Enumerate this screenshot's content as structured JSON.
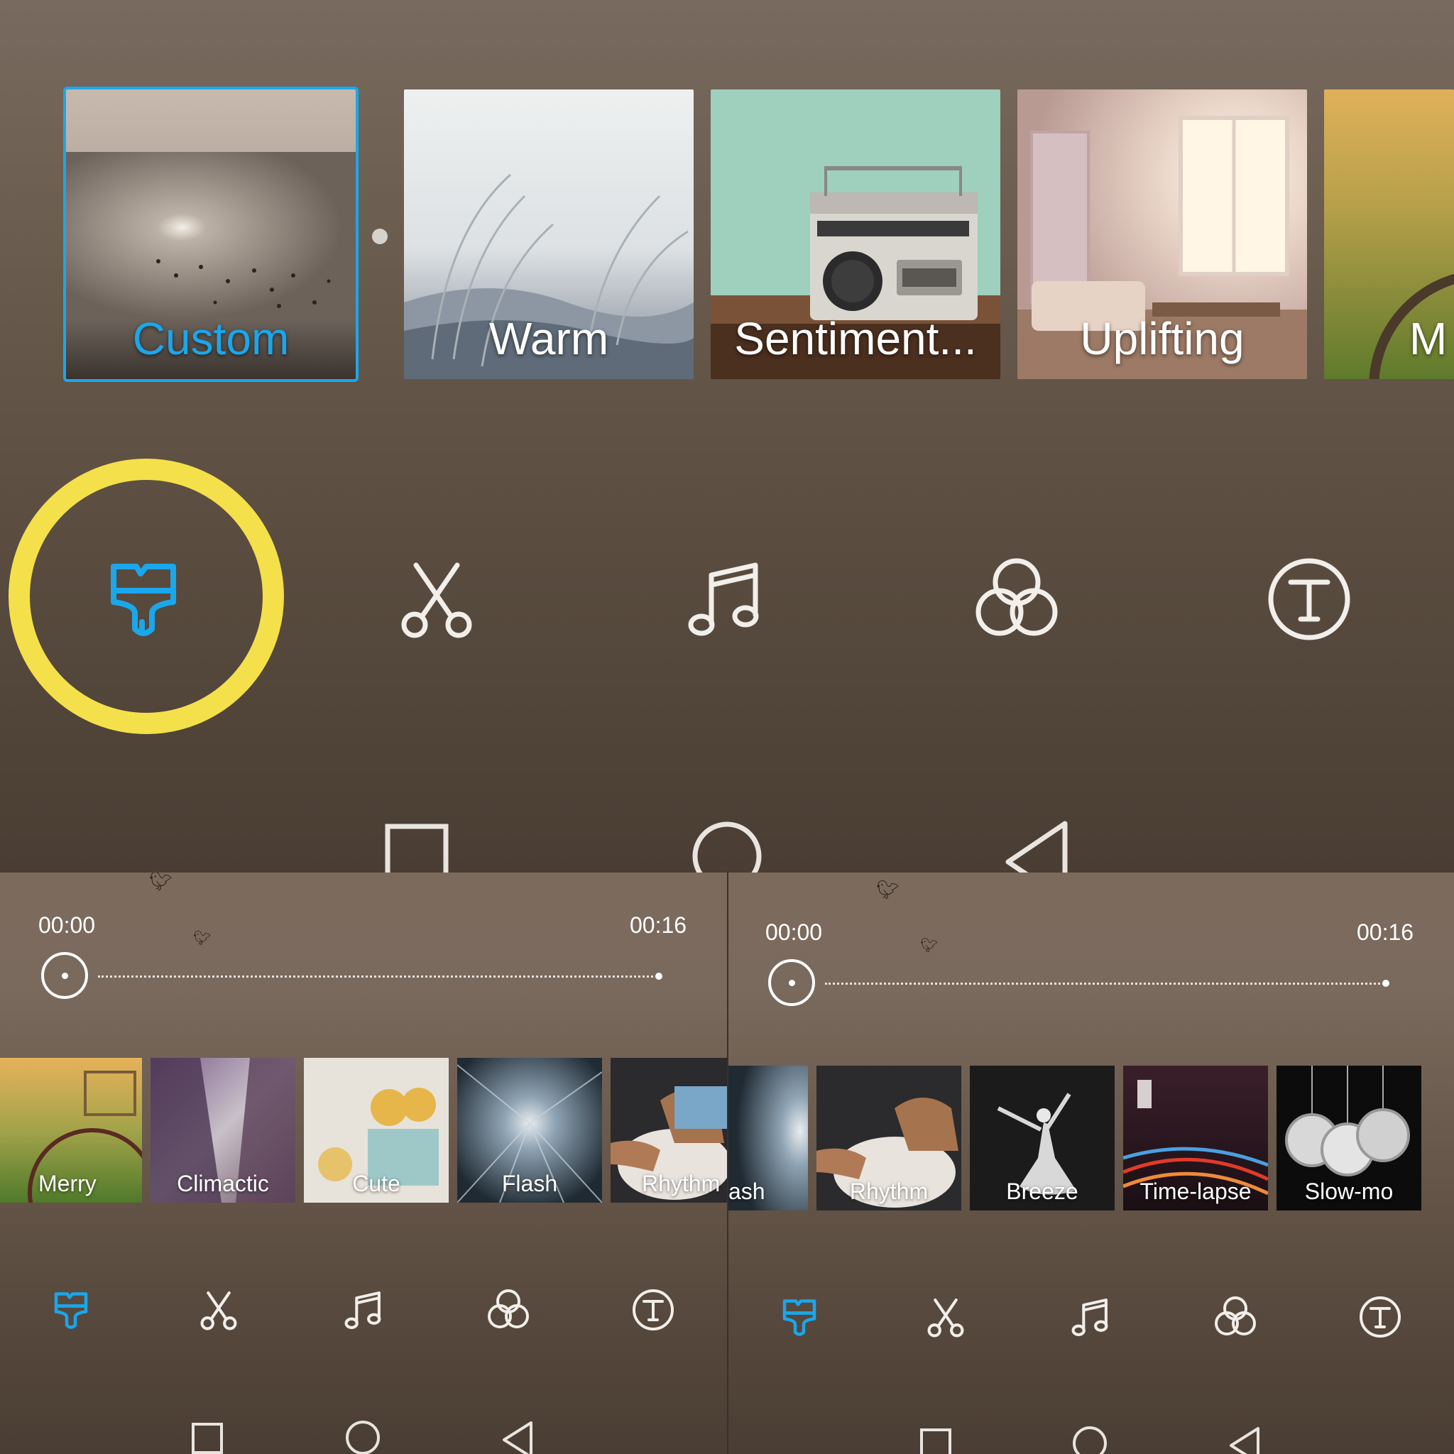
{
  "top_panel": {
    "themes": [
      {
        "label": "Custom",
        "selected": true
      },
      {
        "label": "Warm",
        "selected": false
      },
      {
        "label": "Sentiment...",
        "selected": false
      },
      {
        "label": "Uplifting",
        "selected": false
      },
      {
        "label": "M",
        "selected": false
      }
    ],
    "tools": [
      "theme-brush-icon",
      "scissors-icon",
      "music-note-icon",
      "filter-circles-icon",
      "text-t-icon"
    ],
    "highlight_color": "#f4e04a",
    "accent_color": "#1aa7ec"
  },
  "bottom_left": {
    "time_start": "00:00",
    "time_end": "00:16",
    "playhead_progress": 0,
    "music_styles": [
      "Merry",
      "Climactic",
      "Cute",
      "Flash",
      "Rhythm"
    ]
  },
  "bottom_right": {
    "time_start": "00:00",
    "time_end": "00:16",
    "playhead_progress": 0,
    "music_styles": [
      "ash",
      "Rhythm",
      "Breeze",
      "Time-lapse",
      "Slow-mo"
    ]
  },
  "nav_buttons": [
    "recents-square-icon",
    "home-circle-icon",
    "back-triangle-icon"
  ]
}
